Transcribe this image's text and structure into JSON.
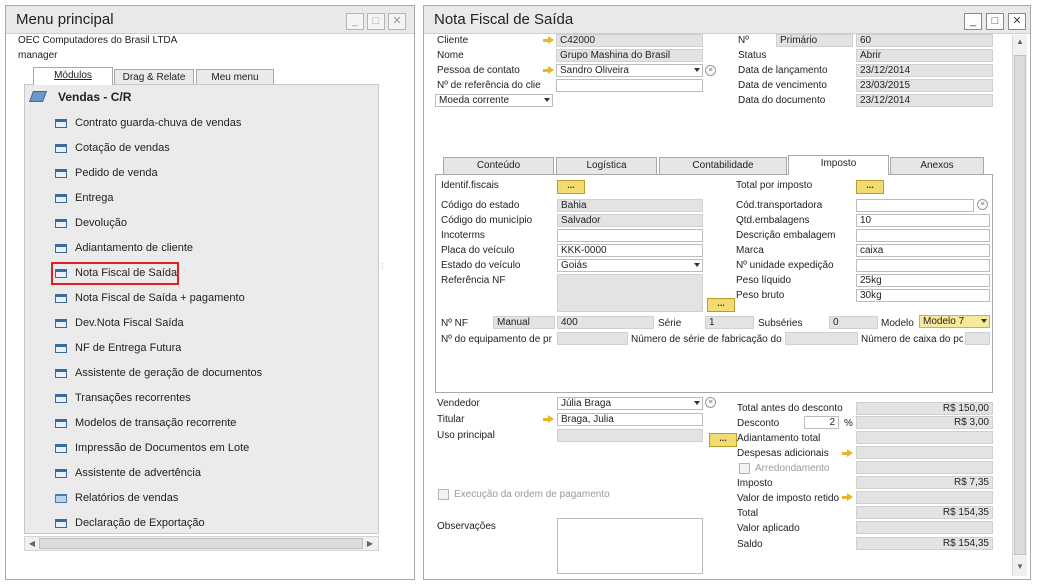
{
  "menu_window": {
    "title": "Menu principal",
    "company": "OEC Computadores do Brasil LTDA",
    "user": "manager",
    "tabs": [
      "Módulos",
      "Drag & Relate",
      "Meu menu"
    ],
    "section": "Vendas - C/R",
    "items": [
      {
        "label": "Contrato guarda-chuva de vendas",
        "icon": "form-icon"
      },
      {
        "label": "Cotação de vendas",
        "icon": "form-icon"
      },
      {
        "label": "Pedido de venda",
        "icon": "form-icon"
      },
      {
        "label": "Entrega",
        "icon": "form-icon"
      },
      {
        "label": "Devolução",
        "icon": "form-icon"
      },
      {
        "label": "Adiantamento de cliente",
        "icon": "form-icon"
      },
      {
        "label": "Nota Fiscal de Saída",
        "icon": "form-icon",
        "highlighted": true
      },
      {
        "label": "Nota Fiscal de Saída + pagamento",
        "icon": "form-icon"
      },
      {
        "label": "Dev.Nota Fiscal Saída",
        "icon": "form-icon"
      },
      {
        "label": "NF de Entrega Futura",
        "icon": "form-icon"
      },
      {
        "label": "Assistente de geração de documentos",
        "icon": "form-icon"
      },
      {
        "label": "Transações recorrentes",
        "icon": "form-icon"
      },
      {
        "label": "Modelos de transação recorrente",
        "icon": "form-icon"
      },
      {
        "label": "Impressão de Documentos em Lote",
        "icon": "form-icon"
      },
      {
        "label": "Assistente de advertência",
        "icon": "form-icon"
      },
      {
        "label": "Relatórios de vendas",
        "icon": "folder-icon"
      },
      {
        "label": "Declaração de Exportação",
        "icon": "form-icon"
      }
    ],
    "highlight_color": "#e02020"
  },
  "invoice": {
    "title": "Nota Fiscal de Saída",
    "header_left": {
      "cliente_label": "Cliente",
      "cliente": "C42000",
      "nome_label": "Nome",
      "nome": "Grupo Mashina do Brasil",
      "contato_label": "Pessoa de contato",
      "contato": "Sandro Oliveira",
      "ref_label": "Nº de referência do clie",
      "ref": "",
      "moeda": "Moeda corrente"
    },
    "header_right": {
      "num_label": "Nº",
      "serie": "Primário",
      "num": "60",
      "status_label": "Status",
      "status": "Abrir",
      "lanc_label": "Data de lançamento",
      "lanc": "23/12/2014",
      "venc_label": "Data de vencimento",
      "venc": "23/03/2015",
      "doc_label": "Data do documento",
      "doc": "23/12/2014"
    },
    "tabs": [
      "Conteúdo",
      "Logística",
      "Contabilidade",
      "Imposto",
      "Anexos"
    ],
    "active_tab": "Imposto",
    "imposto": {
      "identif_label": "Identif.fiscais",
      "codestado_label": "Código do estado",
      "codestado": "Bahia",
      "codmun_label": "Código do município",
      "codmun": "Salvador",
      "incoterms_label": "Incoterms",
      "incoterms": "",
      "placa_label": "Placa do veículo",
      "placa": "KKK-0000",
      "estveic_label": "Estado do veículo",
      "estveic": "Goiás",
      "refnf_label": "Referência NF",
      "totimp_label": "Total por imposto",
      "codtransp_label": "Cód.transportadora",
      "codtransp": "",
      "qtdemb_label": "Qtd.embalagens",
      "qtdemb": "10",
      "descemb_label": "Descrição embalagem",
      "descemb": "",
      "marca_label": "Marca",
      "marca": "caixa",
      "unidade_label": "Nº unidade expedição",
      "unidade": "",
      "pesoliq_label": "Peso líquido",
      "pesoliq": "25kg",
      "pesobruto_label": "Peso bruto",
      "pesobruto": "30kg",
      "nf_label": "Nº NF",
      "nf_tipo": "Manual",
      "nf_num": "400",
      "serie_label": "Série",
      "serie": "1",
      "subseries_label": "Subséries",
      "subseries": "0",
      "modelo_label": "Modelo",
      "modelo": "Modelo 7",
      "equip_label": "Nº do equipamento de pr",
      "numserie_label": "Número de série de fabricação do",
      "caixa_label": "Número de caixa do pc"
    },
    "footer_left": {
      "vendedor_label": "Vendedor",
      "vendedor": "Júlia Braga",
      "titular_label": "Titular",
      "titular": "Braga, Julia",
      "uso_label": "Uso principal",
      "uso": "",
      "exec_label": "Execução da ordem de pagamento",
      "obs_label": "Observações"
    },
    "totals": {
      "tad_label": "Total antes do desconto",
      "tad": "R$ 150,00",
      "desc_label": "Desconto",
      "desc_pct": "2",
      "pct": "%",
      "desc": "R$ 3,00",
      "adiant_label": "Adiantamento total",
      "desp_label": "Despesas adicionais",
      "arred_label": "Arredondamento",
      "imposto_label": "Imposto",
      "imposto": "R$ 7,35",
      "retido_label": "Valor de imposto retido",
      "total_label": "Total",
      "total": "R$ 154,35",
      "aplicado_label": "Valor aplicado",
      "saldo_label": "Saldo",
      "saldo": "R$ 154,35"
    }
  }
}
